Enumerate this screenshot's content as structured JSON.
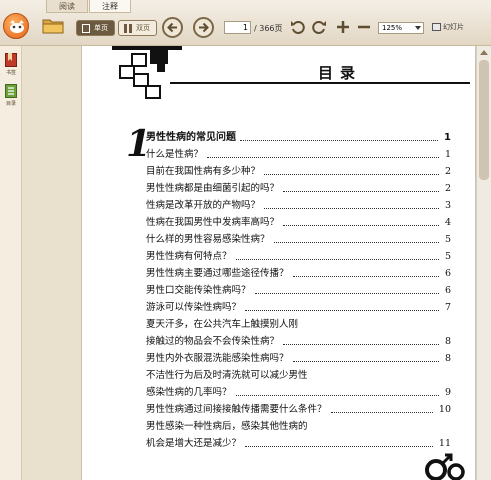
{
  "tabs": [
    {
      "label": "阅读"
    },
    {
      "label": "注释"
    }
  ],
  "toolbar": {
    "single_label": "单页",
    "double_label": "双页",
    "page_current": "1",
    "page_total": "/ 366页",
    "zoom": "125%",
    "slideshow_label": "幻灯片"
  },
  "sidebar": {
    "items": [
      {
        "label": "书签"
      },
      {
        "label": "目录"
      }
    ]
  },
  "page": {
    "title": "目录",
    "chapter_number": "1",
    "entries": [
      {
        "text": "男性性病的常见问题",
        "page": "1",
        "kind": "chapter"
      },
      {
        "text": "什么是性病？",
        "page": "1"
      },
      {
        "text": "目前在我国性病有多少种？",
        "page": "2"
      },
      {
        "text": "男性性病都是由细菌引起的吗？",
        "page": "2"
      },
      {
        "text": "性病是改革开放的产物吗？",
        "page": "3"
      },
      {
        "text": "性病在我国男性中发病率高吗？",
        "page": "4"
      },
      {
        "text": "什么样的男性容易感染性病？",
        "page": "5"
      },
      {
        "text": "男性性病有何特点？",
        "page": "5"
      },
      {
        "text": "男性性病主要通过哪些途径传播？",
        "page": "6"
      },
      {
        "text": "男性口交能传染性病吗？",
        "page": "6"
      },
      {
        "text": "游泳可以传染性病吗？",
        "page": "7"
      },
      {
        "text": "夏天汗多，在公共汽车上触摸别人刚",
        "page": ""
      },
      {
        "text": "接触过的物品会不会传染性病？",
        "page": "8"
      },
      {
        "text": "男性内外衣服混洗能感染性病吗？",
        "page": "8"
      },
      {
        "text": "不洁性行为后及时清洗就可以减少男性",
        "page": ""
      },
      {
        "text": "感染性病的几率吗？",
        "page": "9"
      },
      {
        "text": "男性性病通过间接接触传播需要什么条件？",
        "page": "10"
      },
      {
        "text": "男性感染一种性病后，感染其他性病的",
        "page": ""
      },
      {
        "text": "机会是增大还是减少？",
        "page": "11"
      }
    ]
  }
}
